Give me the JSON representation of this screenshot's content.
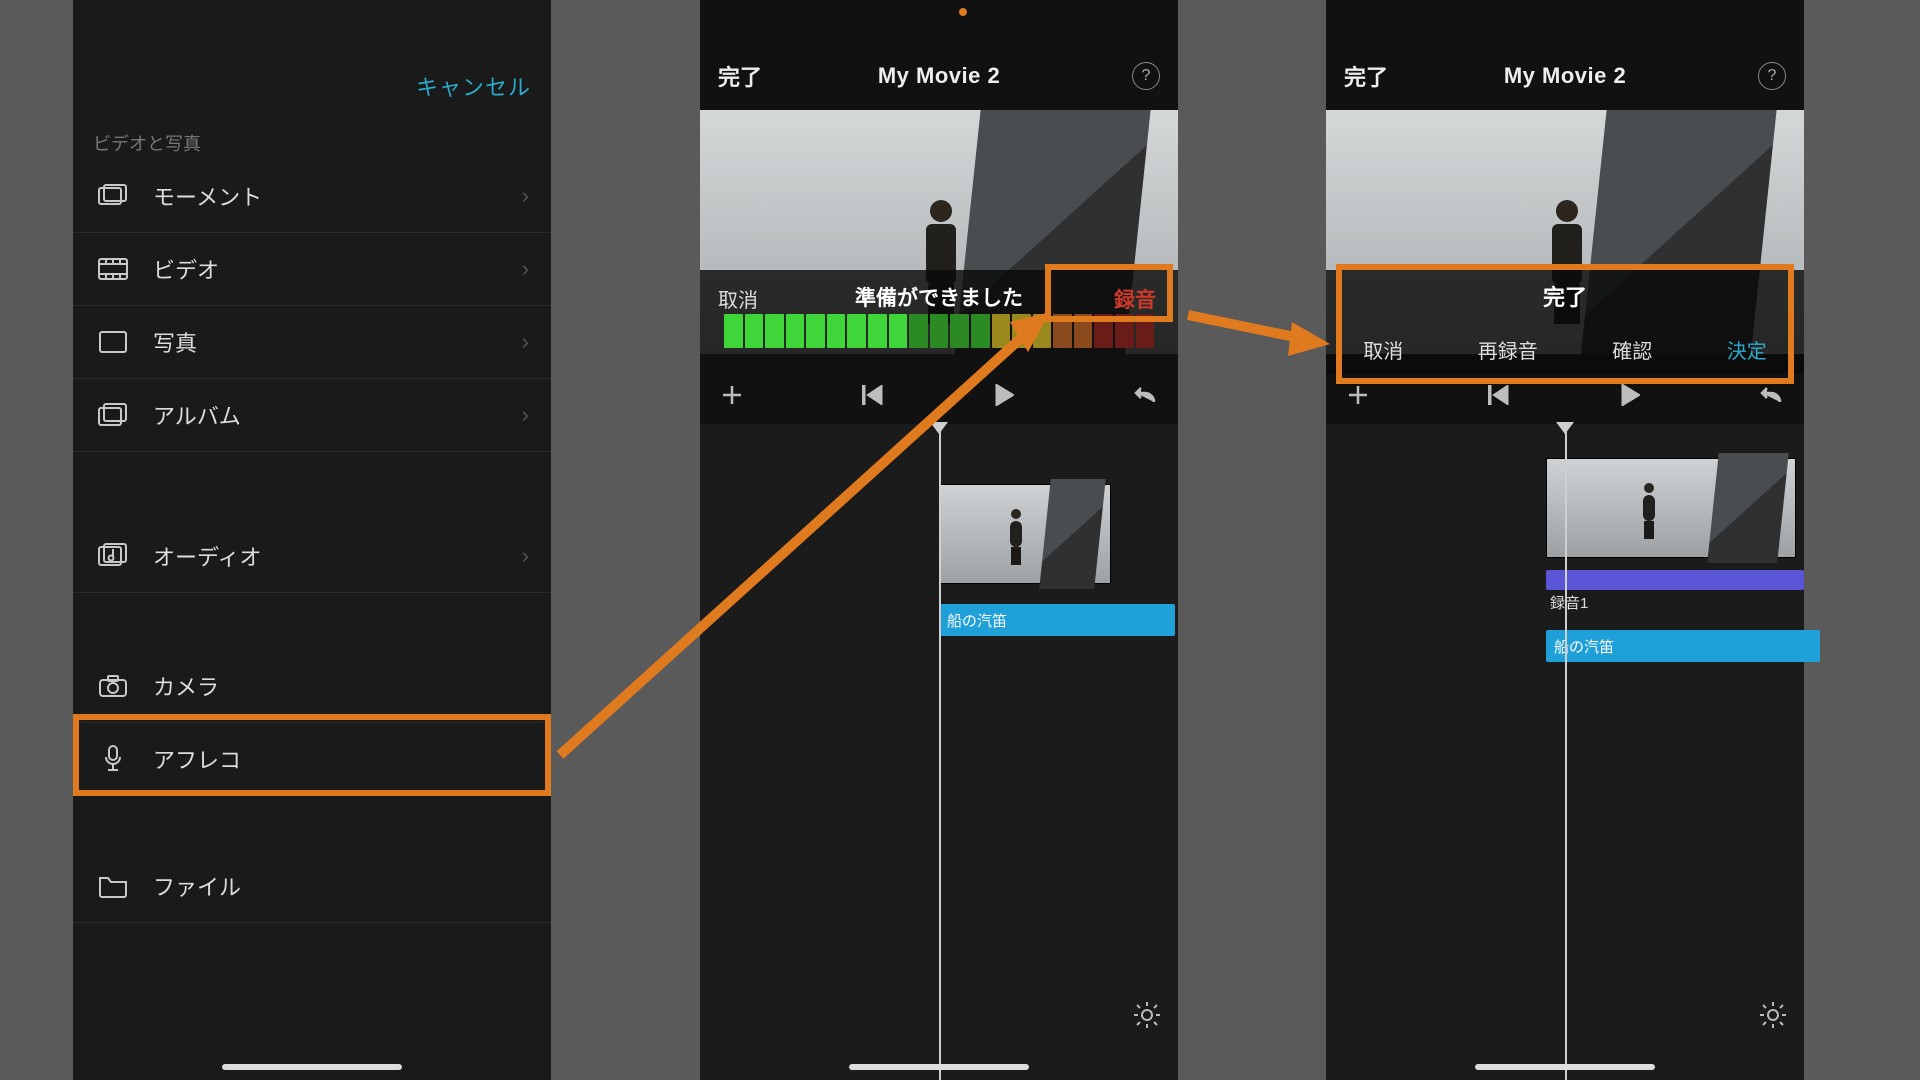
{
  "panel1": {
    "cancel": "キャンセル",
    "section1": "ビデオと写真",
    "moments": "モーメント",
    "video": "ビデオ",
    "photos": "写真",
    "albums": "アルバム",
    "audio": "オーディオ",
    "camera": "カメラ",
    "voiceover": "アフレコ",
    "files": "ファイル"
  },
  "shared": {
    "done": "完了",
    "title": "My Movie 2",
    "help": "?"
  },
  "panel2": {
    "cancel": "取消",
    "ready": "準備ができました",
    "record": "録音",
    "audio_clip": "船の汽笛"
  },
  "panel3": {
    "done_banner": "完了",
    "options": {
      "cancel": "取消",
      "rerecord": "再録音",
      "review": "確認",
      "accept": "決定"
    },
    "rec_clip": "録音1",
    "audio_clip": "船の汽笛"
  }
}
